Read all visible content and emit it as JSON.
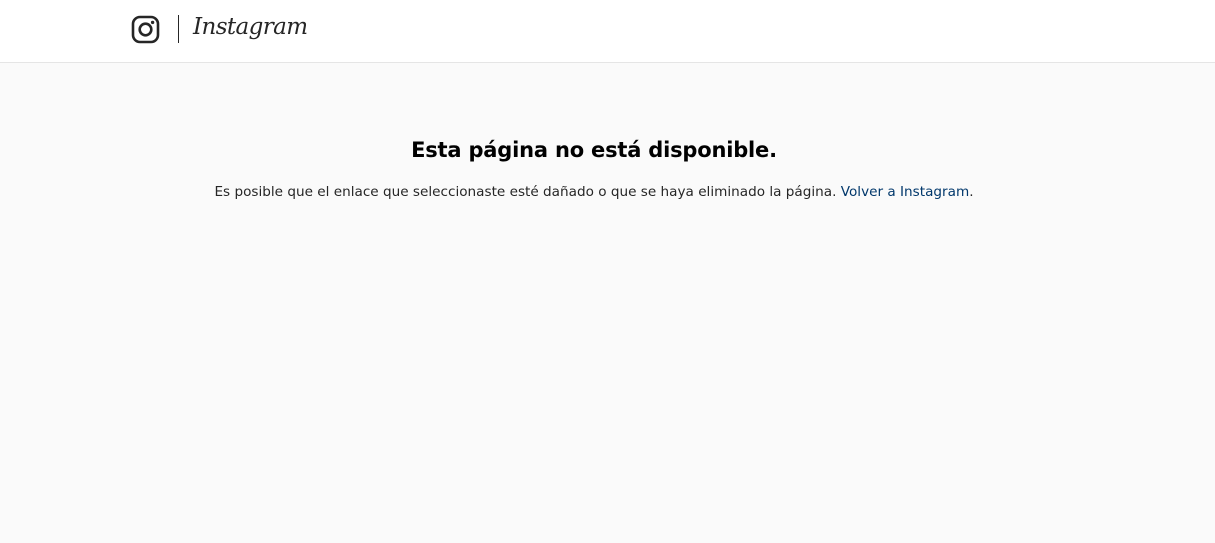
{
  "header": {
    "logo_icon": "instagram-glyph-icon",
    "wordmark": "Instagram"
  },
  "main": {
    "title": "Esta página no está disponible.",
    "message": "Es posible que el enlace que seleccionaste esté dañado o que se haya eliminado la página.",
    "back_link_label": "Volver a Instagram",
    "trailing_period": "."
  },
  "colors": {
    "background": "#fafafa",
    "header_background": "#ffffff",
    "link": "#00376b",
    "text": "#262626"
  }
}
